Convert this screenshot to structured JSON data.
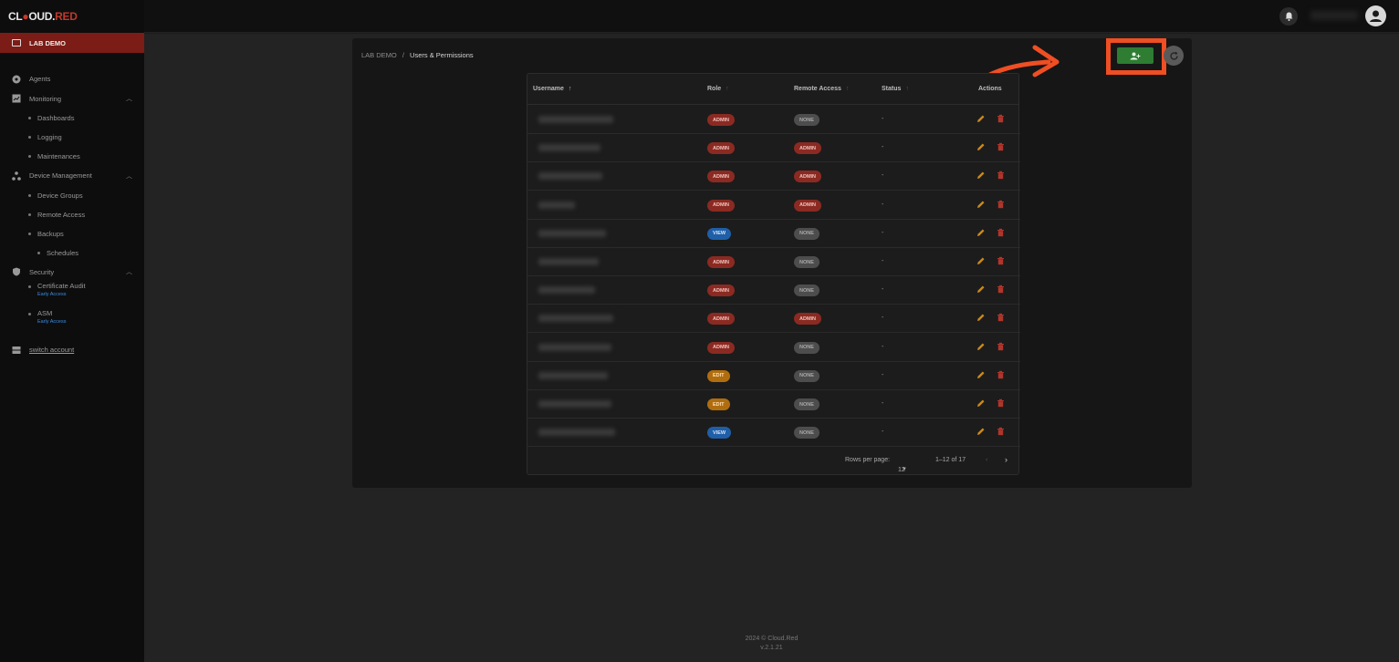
{
  "brand": {
    "logo_a": "CL",
    "logo_b": "OUD.",
    "logo_c": "RED"
  },
  "sidebar": {
    "org": "LAB DEMO",
    "items": [
      {
        "label": "Agents"
      },
      {
        "label": "Monitoring",
        "children": [
          "Dashboards",
          "Logging",
          "Maintenances"
        ]
      },
      {
        "label": "Device Management",
        "children": [
          "Device Groups",
          "Remote Access",
          "Backups"
        ],
        "grandchild": "Schedules"
      },
      {
        "label": "Security",
        "children": [
          {
            "label": "Certificate Audit",
            "tag": "Early Access"
          },
          {
            "label": "ASM",
            "tag": "Early Access"
          }
        ]
      }
    ],
    "switch_account": "switch account"
  },
  "breadcrumb": {
    "root": "LAB DEMO",
    "sep": "/",
    "current": "Users & Permissions"
  },
  "table": {
    "headers": {
      "username": "Username",
      "role": "Role",
      "remote_access": "Remote Access",
      "status": "Status",
      "actions": "Actions"
    },
    "rows": [
      {
        "role": "ADMIN",
        "remote": "NONE",
        "status": "-"
      },
      {
        "role": "ADMIN",
        "remote": "ADMIN",
        "status": "-"
      },
      {
        "role": "ADMIN",
        "remote": "ADMIN",
        "status": "-"
      },
      {
        "role": "ADMIN",
        "remote": "ADMIN",
        "status": "-"
      },
      {
        "role": "VIEW",
        "remote": "NONE",
        "status": "-"
      },
      {
        "role": "ADMIN",
        "remote": "NONE",
        "status": "-"
      },
      {
        "role": "ADMIN",
        "remote": "NONE",
        "status": "-"
      },
      {
        "role": "ADMIN",
        "remote": "ADMIN",
        "status": "-"
      },
      {
        "role": "ADMIN",
        "remote": "NONE",
        "status": "-"
      },
      {
        "role": "EDIT",
        "remote": "NONE",
        "status": "-"
      },
      {
        "role": "EDIT",
        "remote": "NONE",
        "status": "-"
      },
      {
        "role": "VIEW",
        "remote": "NONE",
        "status": "-"
      }
    ],
    "rows_per_page_label": "Rows per page:",
    "rows_per_page": "12",
    "range": "1–12 of 17"
  },
  "footer": {
    "line1": "2024  © Cloud.Red",
    "line2": "v.2.1.21"
  },
  "colors": {
    "accent": "#7c1c16",
    "add_button": "#2e7d32",
    "highlight": "#f04e23"
  },
  "icons": [
    "monitor-icon",
    "agents-icon",
    "monitoring-icon",
    "device-management-icon",
    "security-icon",
    "switch-account-icon",
    "bell-icon",
    "account-icon",
    "add-user-icon",
    "refresh-icon",
    "pencil-icon",
    "trash-icon",
    "sort-arrow-icon",
    "chevron-up-icon",
    "chevron-left-icon",
    "chevron-right-icon",
    "dropdown-icon",
    "curved-arrow-icon"
  ]
}
